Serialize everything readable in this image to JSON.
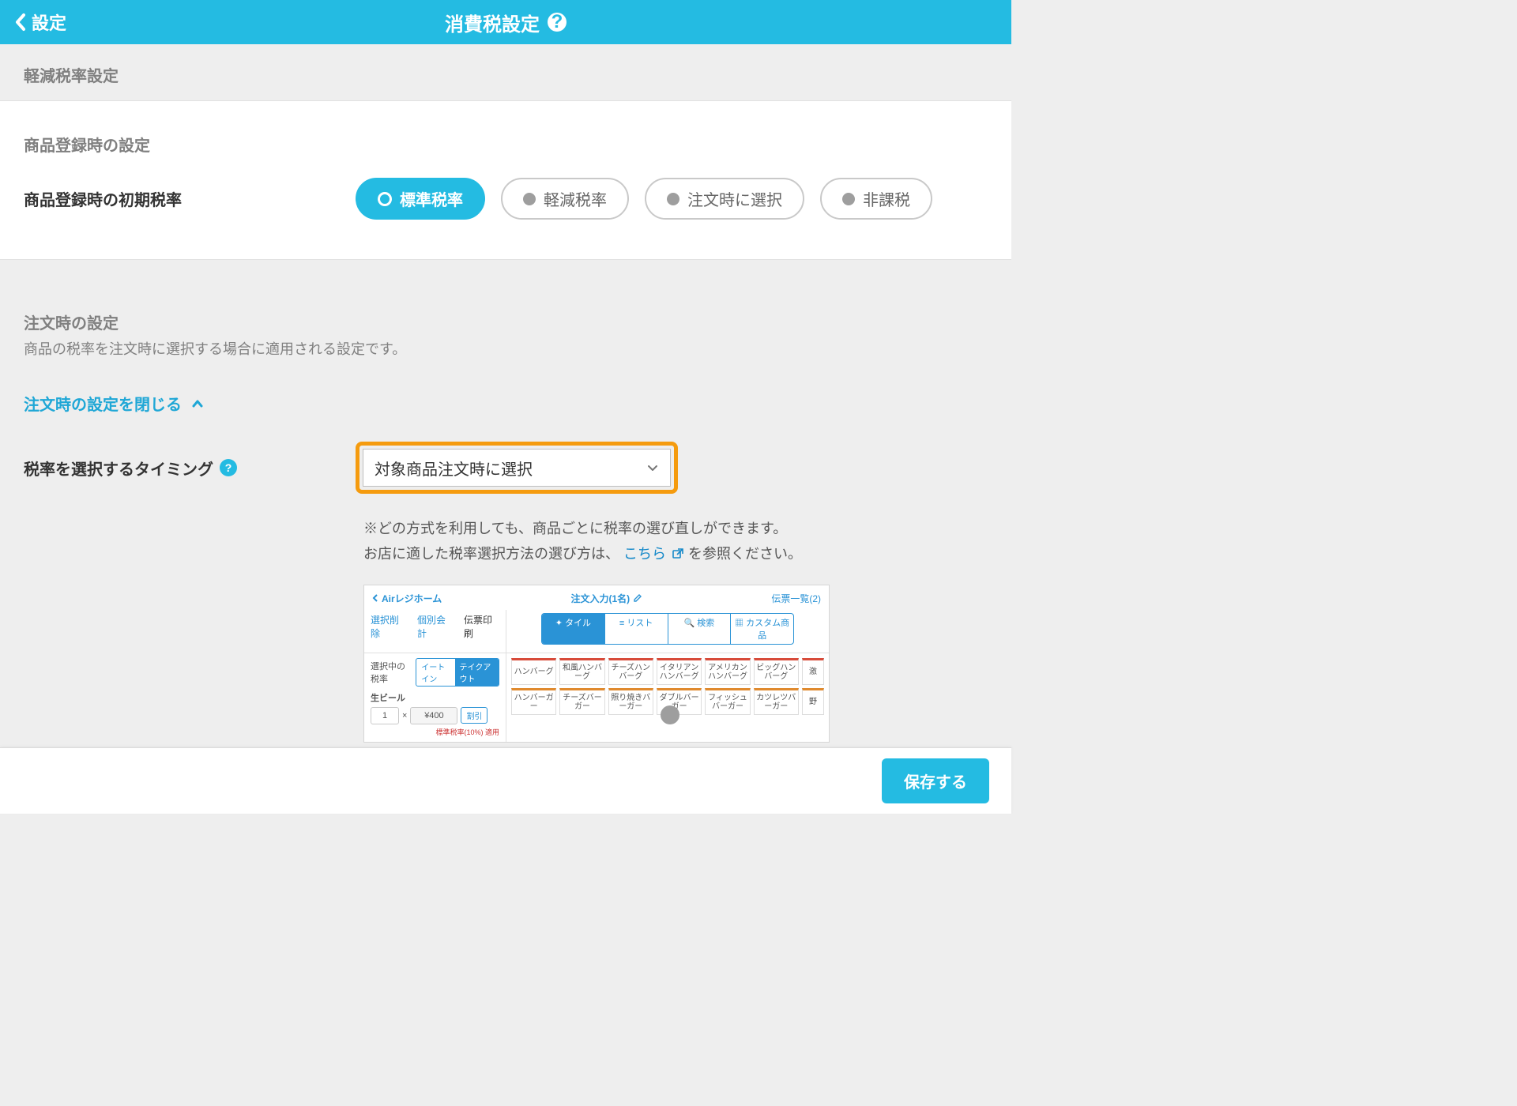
{
  "header": {
    "back_label": "設定",
    "title": "消費税設定"
  },
  "section1": {
    "group_label": "軽減税率設定",
    "card_subhead": "商品登録時の設定",
    "row_label": "商品登録時の初期税率",
    "options": [
      "標準税率",
      "軽減税率",
      "注文時に選択",
      "非課税"
    ],
    "selected_index": 0
  },
  "section2": {
    "subhead": "注文時の設定",
    "desc": "商品の税率を注文時に選択する場合に適用される設定です。",
    "collapse_label": "注文時の設定を閉じる",
    "timing_label": "税率を選択するタイミング",
    "select_value": "対象商品注文時に選択",
    "note1": "※どの方式を利用しても、商品ごとに税率の選び直しができます。",
    "note2_pre": "お店に適した税率選択方法の選び方は、",
    "note2_link": "こちら",
    "note2_post": " を参照ください。"
  },
  "preview": {
    "top_left": "Airレジホーム",
    "top_center": "注文入力(1名)",
    "top_right": "伝票一覧(2)",
    "tabs": [
      "タイル",
      "リスト",
      "検索",
      "カスタム商品"
    ],
    "left_links": [
      "選択削除",
      "個別会計",
      "伝票印刷"
    ],
    "rate_label": "選択中の税率",
    "seg": [
      "イートイン",
      "テイクアウト"
    ],
    "item_name": "生ビール",
    "qty": "1",
    "times": "×",
    "price": "¥400",
    "discount": "割引",
    "tiny": "標準税率(10%) 適用",
    "row1": [
      "ハンバーグ",
      "和風ハンバーグ",
      "チーズハンバーグ",
      "イタリアンハンバーグ",
      "アメリカンハンバーグ",
      "ビッグハンバーグ",
      "激"
    ],
    "row2": [
      "ハンバーガー",
      "チーズバーガー",
      "照り焼きバーガー",
      "ダブルバーガー",
      "フィッシュバーガー",
      "カツレツバーガー",
      "野"
    ]
  },
  "footer": {
    "save": "保存する"
  }
}
